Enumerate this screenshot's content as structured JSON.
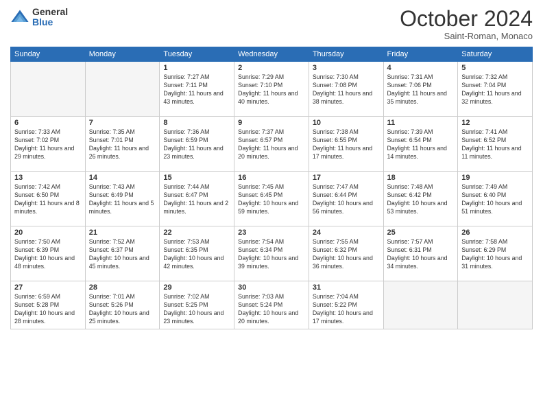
{
  "logo": {
    "general": "General",
    "blue": "Blue"
  },
  "header": {
    "month": "October 2024",
    "location": "Saint-Roman, Monaco"
  },
  "days_of_week": [
    "Sunday",
    "Monday",
    "Tuesday",
    "Wednesday",
    "Thursday",
    "Friday",
    "Saturday"
  ],
  "weeks": [
    [
      {
        "day": "",
        "content": ""
      },
      {
        "day": "",
        "content": ""
      },
      {
        "day": "1",
        "content": "Sunrise: 7:27 AM\nSunset: 7:11 PM\nDaylight: 11 hours and 43 minutes."
      },
      {
        "day": "2",
        "content": "Sunrise: 7:29 AM\nSunset: 7:10 PM\nDaylight: 11 hours and 40 minutes."
      },
      {
        "day": "3",
        "content": "Sunrise: 7:30 AM\nSunset: 7:08 PM\nDaylight: 11 hours and 38 minutes."
      },
      {
        "day": "4",
        "content": "Sunrise: 7:31 AM\nSunset: 7:06 PM\nDaylight: 11 hours and 35 minutes."
      },
      {
        "day": "5",
        "content": "Sunrise: 7:32 AM\nSunset: 7:04 PM\nDaylight: 11 hours and 32 minutes."
      }
    ],
    [
      {
        "day": "6",
        "content": "Sunrise: 7:33 AM\nSunset: 7:02 PM\nDaylight: 11 hours and 29 minutes."
      },
      {
        "day": "7",
        "content": "Sunrise: 7:35 AM\nSunset: 7:01 PM\nDaylight: 11 hours and 26 minutes."
      },
      {
        "day": "8",
        "content": "Sunrise: 7:36 AM\nSunset: 6:59 PM\nDaylight: 11 hours and 23 minutes."
      },
      {
        "day": "9",
        "content": "Sunrise: 7:37 AM\nSunset: 6:57 PM\nDaylight: 11 hours and 20 minutes."
      },
      {
        "day": "10",
        "content": "Sunrise: 7:38 AM\nSunset: 6:55 PM\nDaylight: 11 hours and 17 minutes."
      },
      {
        "day": "11",
        "content": "Sunrise: 7:39 AM\nSunset: 6:54 PM\nDaylight: 11 hours and 14 minutes."
      },
      {
        "day": "12",
        "content": "Sunrise: 7:41 AM\nSunset: 6:52 PM\nDaylight: 11 hours and 11 minutes."
      }
    ],
    [
      {
        "day": "13",
        "content": "Sunrise: 7:42 AM\nSunset: 6:50 PM\nDaylight: 11 hours and 8 minutes."
      },
      {
        "day": "14",
        "content": "Sunrise: 7:43 AM\nSunset: 6:49 PM\nDaylight: 11 hours and 5 minutes."
      },
      {
        "day": "15",
        "content": "Sunrise: 7:44 AM\nSunset: 6:47 PM\nDaylight: 11 hours and 2 minutes."
      },
      {
        "day": "16",
        "content": "Sunrise: 7:45 AM\nSunset: 6:45 PM\nDaylight: 10 hours and 59 minutes."
      },
      {
        "day": "17",
        "content": "Sunrise: 7:47 AM\nSunset: 6:44 PM\nDaylight: 10 hours and 56 minutes."
      },
      {
        "day": "18",
        "content": "Sunrise: 7:48 AM\nSunset: 6:42 PM\nDaylight: 10 hours and 53 minutes."
      },
      {
        "day": "19",
        "content": "Sunrise: 7:49 AM\nSunset: 6:40 PM\nDaylight: 10 hours and 51 minutes."
      }
    ],
    [
      {
        "day": "20",
        "content": "Sunrise: 7:50 AM\nSunset: 6:39 PM\nDaylight: 10 hours and 48 minutes."
      },
      {
        "day": "21",
        "content": "Sunrise: 7:52 AM\nSunset: 6:37 PM\nDaylight: 10 hours and 45 minutes."
      },
      {
        "day": "22",
        "content": "Sunrise: 7:53 AM\nSunset: 6:35 PM\nDaylight: 10 hours and 42 minutes."
      },
      {
        "day": "23",
        "content": "Sunrise: 7:54 AM\nSunset: 6:34 PM\nDaylight: 10 hours and 39 minutes."
      },
      {
        "day": "24",
        "content": "Sunrise: 7:55 AM\nSunset: 6:32 PM\nDaylight: 10 hours and 36 minutes."
      },
      {
        "day": "25",
        "content": "Sunrise: 7:57 AM\nSunset: 6:31 PM\nDaylight: 10 hours and 34 minutes."
      },
      {
        "day": "26",
        "content": "Sunrise: 7:58 AM\nSunset: 6:29 PM\nDaylight: 10 hours and 31 minutes."
      }
    ],
    [
      {
        "day": "27",
        "content": "Sunrise: 6:59 AM\nSunset: 5:28 PM\nDaylight: 10 hours and 28 minutes."
      },
      {
        "day": "28",
        "content": "Sunrise: 7:01 AM\nSunset: 5:26 PM\nDaylight: 10 hours and 25 minutes."
      },
      {
        "day": "29",
        "content": "Sunrise: 7:02 AM\nSunset: 5:25 PM\nDaylight: 10 hours and 23 minutes."
      },
      {
        "day": "30",
        "content": "Sunrise: 7:03 AM\nSunset: 5:24 PM\nDaylight: 10 hours and 20 minutes."
      },
      {
        "day": "31",
        "content": "Sunrise: 7:04 AM\nSunset: 5:22 PM\nDaylight: 10 hours and 17 minutes."
      },
      {
        "day": "",
        "content": ""
      },
      {
        "day": "",
        "content": ""
      }
    ]
  ]
}
